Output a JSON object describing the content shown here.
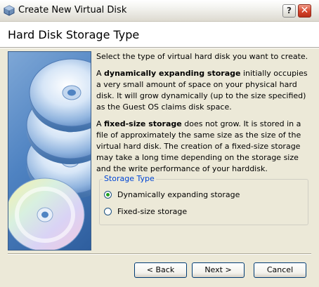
{
  "window": {
    "title": "Create New Virtual Disk",
    "help_label": "?",
    "close_label": "✕"
  },
  "header": {
    "title": "Hard Disk Storage Type"
  },
  "content": {
    "intro": "Select the type of virtual hard disk you want to create.",
    "dynamic_bold": "dynamically expanding storage",
    "dynamic_prefix": "A ",
    "dynamic_text": " initially occupies a very small amount of space on your physical hard disk. It will grow dynamically (up to the size specified) as the Guest OS claims disk space.",
    "fixed_prefix": "A ",
    "fixed_bold": "fixed-size storage",
    "fixed_text": " does not grow. It is stored in a file of approximately the same size as the size of the virtual hard disk. The creation of a fixed-size storage may take a long time depending on the storage size and the write performance of your harddisk."
  },
  "storage_type": {
    "legend": "Storage Type",
    "options": [
      {
        "label": "Dynamically expanding storage",
        "checked": true
      },
      {
        "label": "Fixed-size storage",
        "checked": false
      }
    ]
  },
  "buttons": {
    "back": "< Back",
    "next": "Next >",
    "cancel": "Cancel"
  },
  "colors": {
    "legend": "#0046D5",
    "radio_dot": "#21A121",
    "close_button": "#D5432A"
  }
}
